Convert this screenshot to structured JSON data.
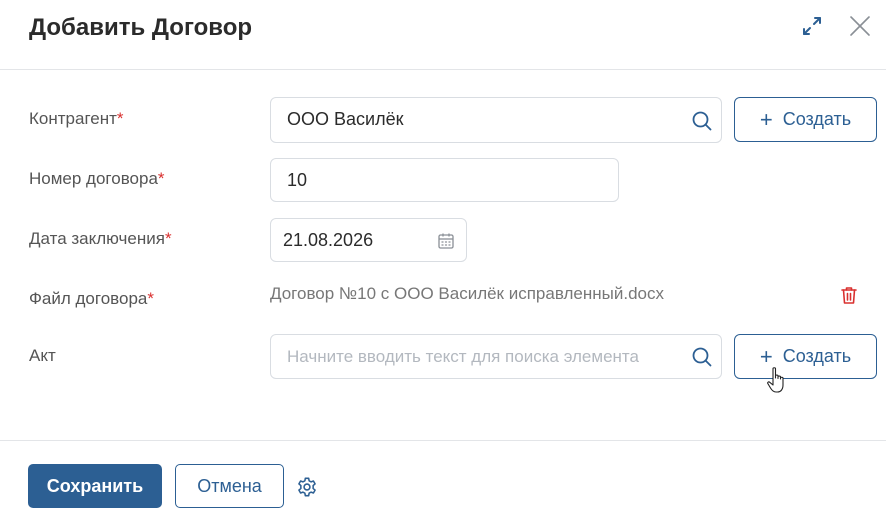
{
  "header": {
    "title": "Добавить Договор",
    "expand_icon": "expand-icon",
    "close_icon": "close-icon"
  },
  "form": {
    "contractor": {
      "label": "Контрагент",
      "required_mark": "*",
      "value": "ООО Василёк",
      "create_label": "Создать"
    },
    "contract_number": {
      "label": "Номер договора",
      "required_mark": "*",
      "value": "10"
    },
    "date": {
      "label": "Дата заключения",
      "required_mark": "*",
      "value": "21.08.2026"
    },
    "file": {
      "label": "Файл договора",
      "required_mark": "*",
      "file_name": "Договор №10 с ООО Василёк исправленный.docx"
    },
    "act": {
      "label": "Акт",
      "placeholder": "Начните вводить текст для поиска элемента",
      "create_label": "Создать"
    }
  },
  "footer": {
    "save_label": "Сохранить",
    "cancel_label": "Отмена"
  },
  "colors": {
    "primary": "#2c5f93",
    "required": "#d9302f",
    "border": "#d9dde2",
    "placeholder": "#b3b8bf"
  }
}
